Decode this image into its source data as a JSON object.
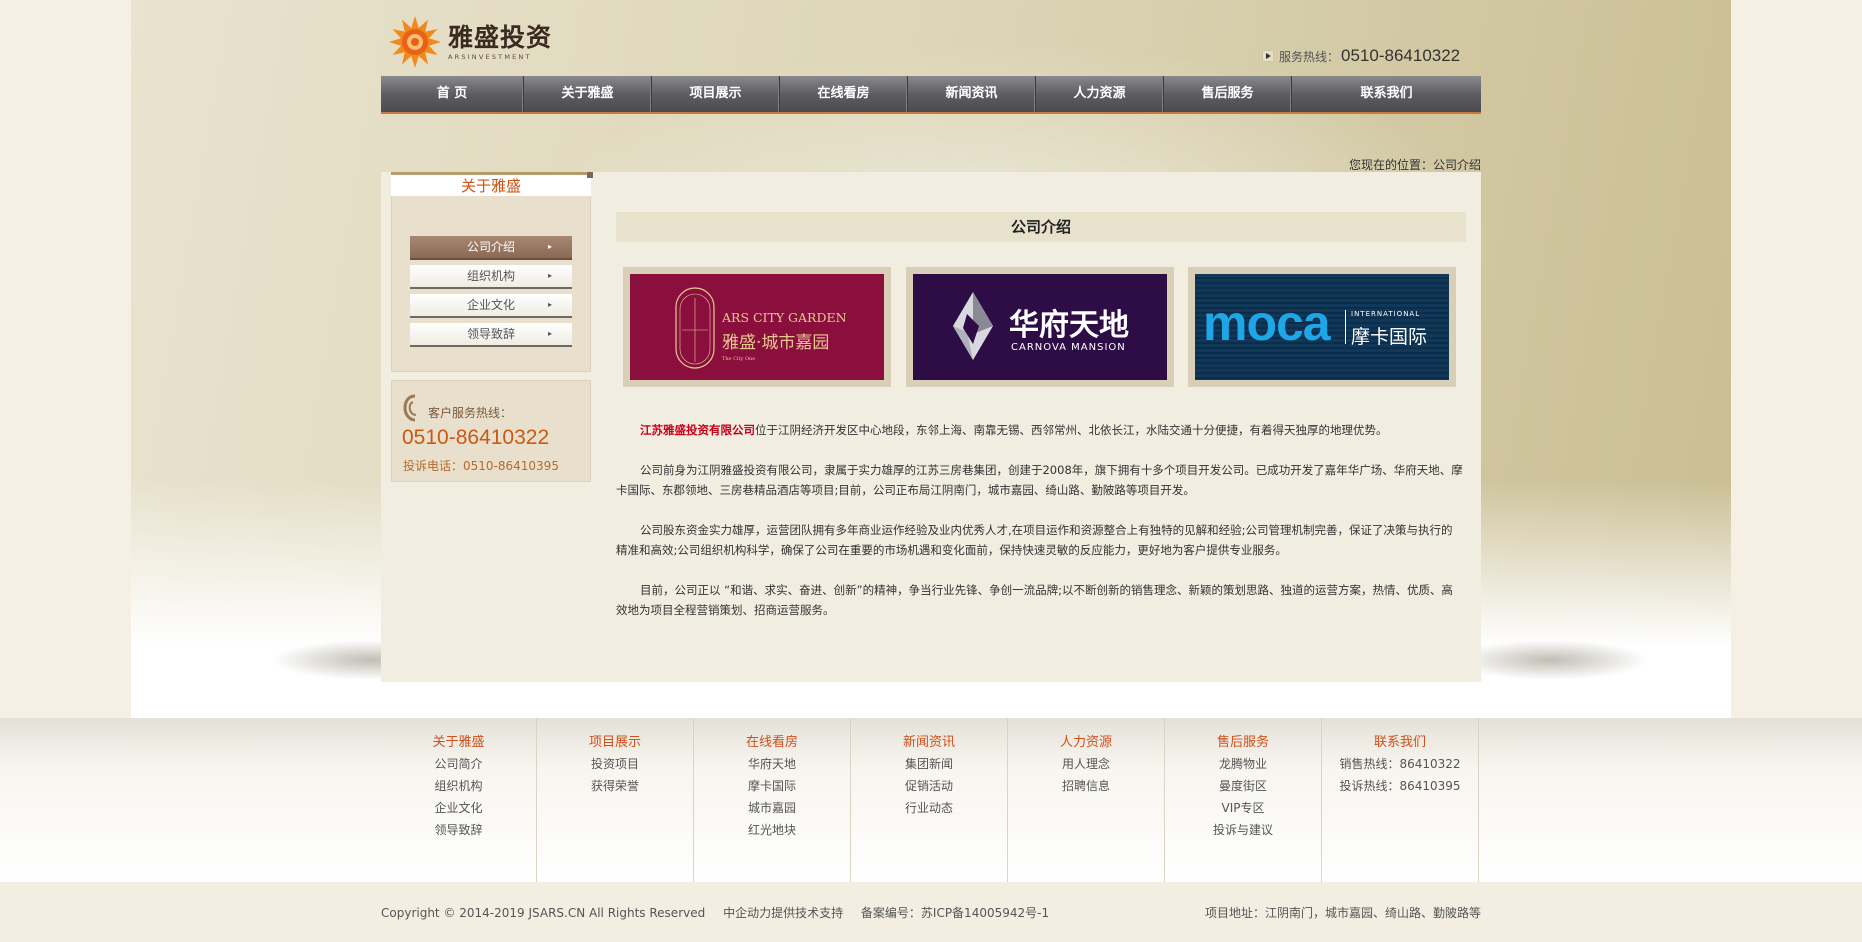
{
  "header": {
    "logo_cn": "雅盛投资",
    "logo_en": "ARSINVESTMENT",
    "hotline_label": "服务热线：",
    "hotline_number": "0510-86410322"
  },
  "nav": {
    "items": [
      "首 页",
      "关于雅盛",
      "项目展示",
      "在线看房",
      "新闻资讯",
      "人力资源",
      "售后服务",
      "联系我们"
    ]
  },
  "breadcrumb": "您现在的位置：公司介绍",
  "sidebar": {
    "title": "关于雅盛",
    "items": [
      {
        "label": "公司介绍",
        "arrow": "▸"
      },
      {
        "label": "组织机构",
        "arrow": "▸"
      },
      {
        "label": "企业文化",
        "arrow": "▸"
      },
      {
        "label": "领导致辞",
        "arrow": "▸"
      }
    ],
    "contact_label": "客户服务热线：",
    "contact_number": "0510-86410322",
    "complaint": "投诉电话：0510-86410395"
  },
  "content": {
    "title": "公司介绍",
    "banners": [
      {
        "en": "ARS CITY GARDEN",
        "cn": "雅盛·城市嘉园",
        "sub": "The City One"
      },
      {
        "cn": "华府天地",
        "en": "CARNOVA MANSION"
      },
      {
        "en": "moca",
        "small": "INTERNATIONAL",
        "cn": "摩卡国际"
      }
    ],
    "para1_highlight": "江苏雅盛投资有限公司",
    "para1_rest": "位于江阴经济开发区中心地段，东邻上海、南靠无锡、西邻常州、北依长江，水陆交通十分便捷，有着得天独厚的地理优势。",
    "para2": "公司前身为江阴雅盛投资有限公司，隶属于实力雄厚的江苏三房巷集团，创建于2008年，旗下拥有十多个项目开发公司。已成功开发了嘉年华广场、华府天地、摩卡国际、东郡领地、三房巷精品酒店等项目;目前，公司正布局江阴南门，城市嘉园、绮山路、勤陂路等项目开发。",
    "para3": "公司股东资金实力雄厚，运营团队拥有多年商业运作经验及业内优秀人才,在项目运作和资源整合上有独特的见解和经验;公司管理机制完善，保证了决策与执行的精准和高效;公司组织机构科学，确保了公司在重要的市场机遇和变化面前，保持快速灵敏的反应能力，更好地为客户提供专业服务。",
    "para4": "目前，公司正以 “和谐、求实、奋进、创新”的精神，争当行业先锋、争创一流品牌;以不断创新的销售理念、新颖的策划思路、独道的运营方案，热情、优质、高效地为项目全程营销策划、招商运营服务。"
  },
  "footer": {
    "columns": [
      {
        "title": "关于雅盛",
        "links": [
          "公司简介",
          "组织机构",
          "企业文化",
          "领导致辞"
        ]
      },
      {
        "title": "项目展示",
        "links": [
          "投资项目",
          "获得荣誉"
        ]
      },
      {
        "title": "在线看房",
        "links": [
          "华府天地",
          "摩卡国际",
          "城市嘉园",
          "红光地块"
        ]
      },
      {
        "title": "新闻资讯",
        "links": [
          "集团新闻",
          "促销活动",
          "行业动态"
        ]
      },
      {
        "title": "人力资源",
        "links": [
          "用人理念",
          "招聘信息"
        ]
      },
      {
        "title": "售后服务",
        "links": [
          "龙腾物业",
          "曼度街区",
          "VIP专区",
          "投诉与建议"
        ]
      },
      {
        "title": "联系我们",
        "links": [
          "销售热线：86410322",
          "投诉热线：86410395"
        ]
      }
    ],
    "copyright": "Copyright © 2014-2019 JSARS.CN All Rights Reserved",
    "support": "中企动力提供技术支持",
    "icp": "备案编号：苏ICP备14005942号-1",
    "address": "项目地址：江阴南门，城市嘉园、绮山路、勤陂路等"
  },
  "colors": {
    "accent": "#d0501a",
    "nav_bg": "#5d5d62",
    "highlight": "#c8001a"
  }
}
